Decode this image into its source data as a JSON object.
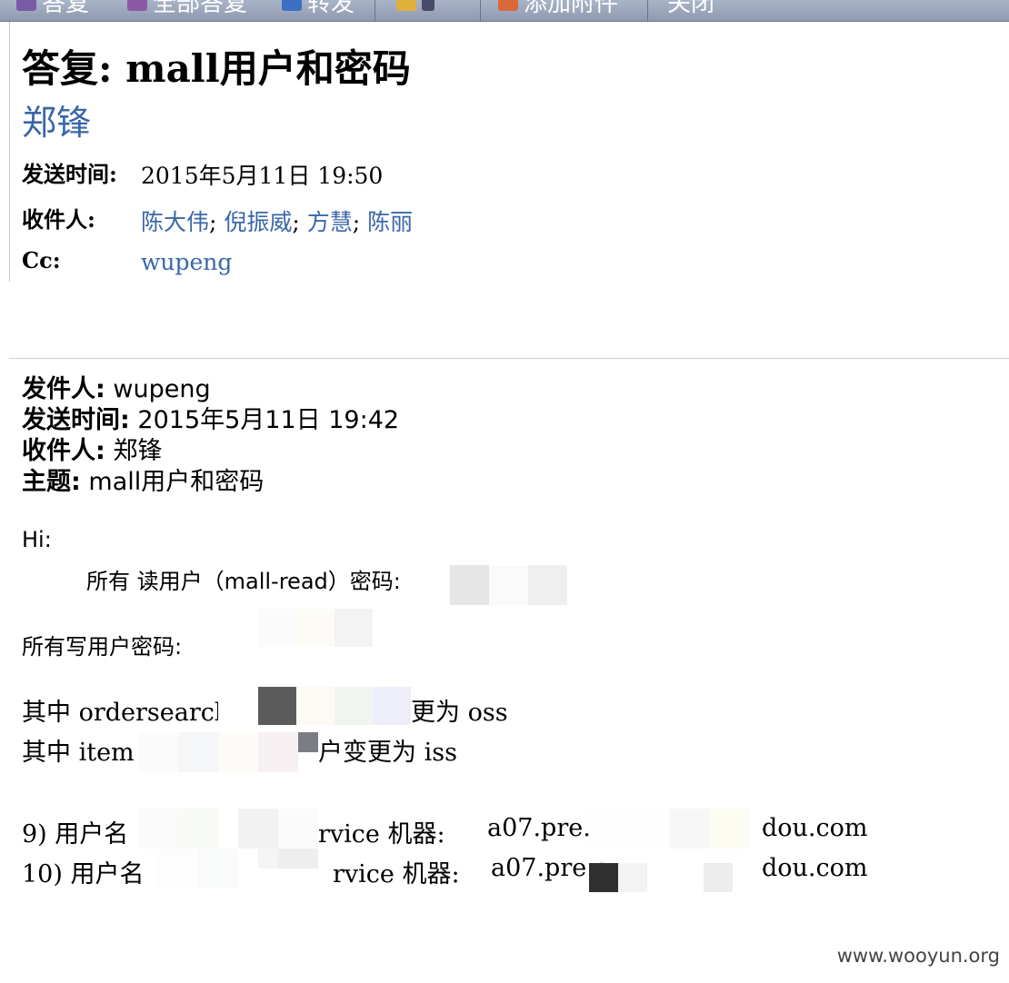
{
  "toolbar": {
    "items": [
      {
        "label": "答复",
        "icon": "reply-icon"
      },
      {
        "label": "全部答复",
        "icon": "reply-all-icon"
      },
      {
        "label": "转发",
        "icon": "forward-icon"
      },
      {
        "label": "",
        "icon": "file-icon"
      },
      {
        "label": "添加附件",
        "icon": "attach-icon"
      },
      {
        "label": "关闭",
        "icon": "close-icon"
      }
    ]
  },
  "message": {
    "subject": "答复: mall用户和密码",
    "sender": "郑锋",
    "headers": {
      "sent_label": "发送时间:",
      "sent_value": "2015年5月11日 19:50",
      "to_label": "收件人:",
      "to_recipients": [
        "陈大伟",
        "倪振威",
        "方慧",
        "陈丽"
      ],
      "cc_label": "Cc:",
      "cc_value": "wupeng"
    }
  },
  "original": {
    "from_label": "发件人:",
    "from_value": "wupeng",
    "sent_label": "发送时间:",
    "sent_value": "2015年5月11日 19:42",
    "to_label": "收件人:",
    "to_value": "郑锋",
    "subject_label": "主题:",
    "subject_value": "mall用户和密码"
  },
  "body": {
    "greeting": "Hi:",
    "read_user_line": "所有 读用户（mall-read）密码:",
    "write_user_line": "所有写用户密码:",
    "line_oss_prefix": "其中 ordersearcl",
    "line_oss_suffix": "更为 oss",
    "line_iss_prefix": "其中 item",
    "line_iss_suffix": "户变更为 iss",
    "row9_prefix": "9) 用户名",
    "row9_mid": "rvice 机器:",
    "row9_host": "a07.pre.c",
    "row9_domain": "dou.com",
    "row10_prefix": "10) 用户名",
    "row10_mid": "rvice 机器:",
    "row10_host": "a07.pre.c",
    "row10_domain": "dou.com"
  },
  "watermark": "www.wooyun.org",
  "colors": {
    "link": "#3a67a8",
    "toolbar": "#9aa5bb"
  }
}
